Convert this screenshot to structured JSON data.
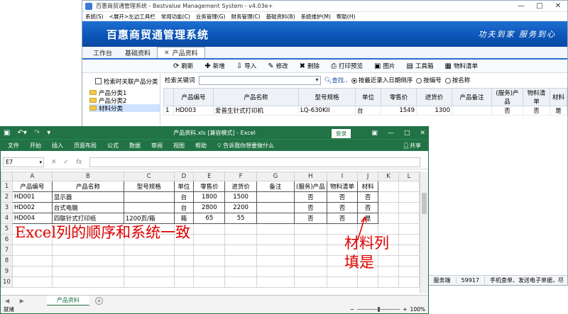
{
  "mgmt": {
    "title": "百惠商贸通管理系统 - Bestvalue Management System - v4.03e+",
    "window_controls": [
      "—",
      "□",
      "✕"
    ],
    "menu": [
      "系统(S)",
      "<展开>左边工具栏",
      "常用功能(C)",
      "业务管理(G)",
      "财务管理(C)",
      "基础资料(B)",
      "系统维护(M)",
      "帮助(H)"
    ],
    "banner_name": "百惠商贸通管理系统",
    "banner_slogan": "功夫到家  服务到心",
    "tabs": [
      "工作台",
      "基础资料",
      "产品资料"
    ],
    "toolbar": [
      {
        "icon": "refresh-icon",
        "glyph": "⟳",
        "label": "刷新"
      },
      {
        "icon": "add-icon",
        "glyph": "✚",
        "label": "新增"
      },
      {
        "icon": "import-icon",
        "glyph": "⇩",
        "label": "导入"
      },
      {
        "icon": "edit-icon",
        "glyph": "✎",
        "label": "修改"
      },
      {
        "icon": "delete-icon",
        "glyph": "✖",
        "label": "删除"
      },
      {
        "icon": "print-icon",
        "glyph": "⎙",
        "label": "打印预览"
      },
      {
        "icon": "image-icon",
        "glyph": "▣",
        "label": "图片"
      },
      {
        "icon": "toolbox-icon",
        "glyph": "▤",
        "label": "工具箱"
      },
      {
        "icon": "material-list-icon",
        "glyph": "▦",
        "label": "物料清单"
      }
    ],
    "tree_checkbox_label": "检索时关联产品分类",
    "tree": [
      "产品分类1",
      "产品分类2",
      "材料分类"
    ],
    "search_label": "检索关键词",
    "search_value": "",
    "search_button": "查找..",
    "radios": [
      {
        "label": "按最近录入日期倒序",
        "checked": true
      },
      {
        "label": "按编号",
        "checked": false
      },
      {
        "label": "按名称",
        "checked": false
      }
    ],
    "grid_headers": [
      "",
      "产品编号",
      "产品名称",
      "型号规格",
      "单位",
      "零售价",
      "进货价",
      "产品备注",
      "(服务)产品",
      "物料清单",
      "材料"
    ],
    "grid_rows": [
      [
        "1",
        "HD003",
        "爱普生针式打印机",
        "LQ-630KII",
        "台",
        "1549",
        "1300",
        "",
        "否",
        "否",
        "是"
      ]
    ],
    "status": [
      "服务端",
      "59917",
      "手机查单、发送电子单据，尽"
    ]
  },
  "excel": {
    "quick_access": [
      "save-icon",
      "undo-icon",
      "redo-icon",
      "customize-icon"
    ],
    "title": "产品资料.xls  [兼容模式]  -  Excel",
    "login": "登录",
    "window_controls": [
      "▣",
      "—",
      "□",
      "✕"
    ],
    "ribbon": [
      "文件",
      "开始",
      "插入",
      "页面布局",
      "公式",
      "数据",
      "审阅",
      "视图",
      "帮助"
    ],
    "tell_me": "告诉我你想要做什么",
    "share": "共享",
    "name_box": "E7",
    "fx_buttons": [
      "✕",
      "✓",
      "fx"
    ],
    "col_letters": [
      "",
      "A",
      "B",
      "C",
      "D",
      "E",
      "F",
      "G",
      "H",
      "I",
      "J",
      "K",
      "L"
    ],
    "rows": [
      [
        "产品编号",
        "产品名称",
        "型号规格",
        "单位",
        "零售价",
        "进货价",
        "备注",
        "(服务)产品",
        "物料清单",
        "材料",
        "",
        ""
      ],
      [
        "HD001",
        "显示器",
        "",
        "台",
        "1800",
        "1500",
        "",
        "否",
        "否",
        "否",
        "",
        ""
      ],
      [
        "HD002",
        "台式电脑",
        "",
        "台",
        "2800",
        "2200",
        "",
        "否",
        "否",
        "否",
        "",
        ""
      ],
      [
        "HD004",
        "四联针式打印纸",
        "1200页/箱",
        "箱",
        "65",
        "55",
        "",
        "否",
        "否",
        "是",
        "",
        ""
      ],
      [
        "",
        "",
        "",
        "",
        "",
        "",
        "",
        "",
        "",
        "",
        "",
        ""
      ],
      [
        "",
        "",
        "",
        "",
        "",
        "",
        "",
        "",
        "",
        "",
        "",
        ""
      ],
      [
        "",
        "",
        "",
        "",
        "",
        "",
        "",
        "",
        "",
        "",
        "",
        ""
      ],
      [
        "",
        "",
        "",
        "",
        "",
        "",
        "",
        "",
        "",
        "",
        "",
        ""
      ],
      [
        "",
        "",
        "",
        "",
        "",
        "",
        "",
        "",
        "",
        "",
        "",
        ""
      ],
      [
        "",
        "",
        "",
        "",
        "",
        "",
        "",
        "",
        "",
        "",
        "",
        ""
      ]
    ],
    "sheet_nav": "◀ ▶",
    "sheet_tab": "产品资料",
    "status_left": "就绪",
    "zoom": "100%"
  },
  "annotations": {
    "excel_note": "Excel列的顺序和系统一致",
    "material_note_line1": "材料列",
    "material_note_line2": "填是",
    "color": "#e00000"
  }
}
